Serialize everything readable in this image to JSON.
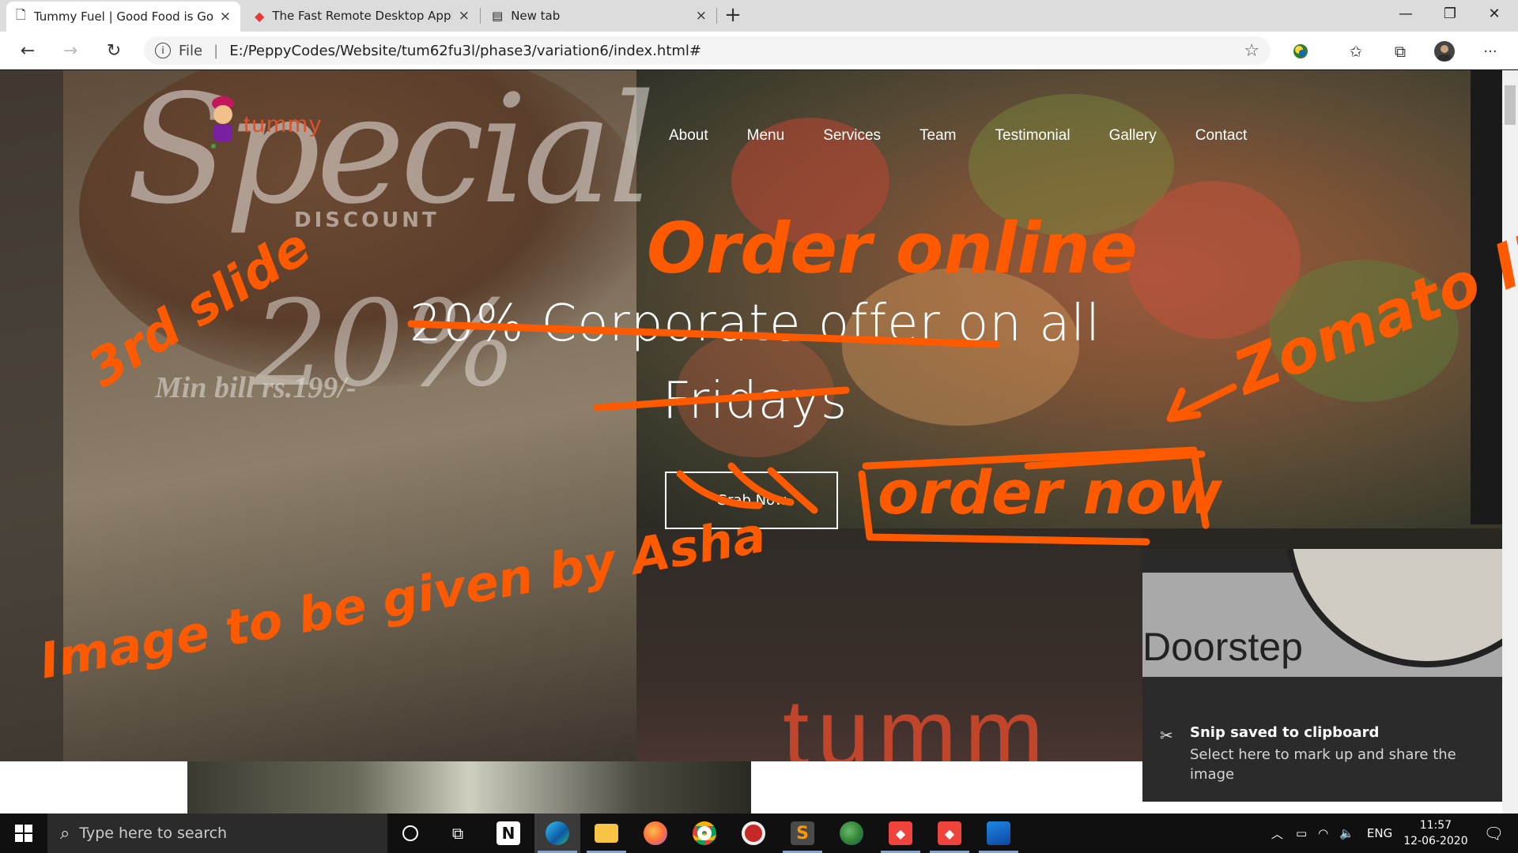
{
  "browser": {
    "tabs": [
      {
        "title": "Tummy Fuel | Good Food is Goo",
        "close": "×"
      },
      {
        "title": "The Fast Remote Desktop Applic",
        "close": "×"
      },
      {
        "title": "New tab",
        "close": "×"
      }
    ],
    "new_tab": "+",
    "window_controls": {
      "minimize": "—",
      "maximize": "❐",
      "close": "✕"
    },
    "address": {
      "scheme_label": "File",
      "separator": "|",
      "url": "E:/PeppyCodes/Website/tum62fu3l/phase3/variation6/index.html#"
    },
    "more_menu": "···"
  },
  "site": {
    "logo_text": "tummy",
    "nav": [
      "About",
      "Menu",
      "Services",
      "Team",
      "Testimonial",
      "Gallery",
      "Contact"
    ],
    "hero_title": "20% Corporate offer on all Fridays",
    "hero_button": "Grab Now",
    "background_text": {
      "special": "Special",
      "discount": "DISCOUNT",
      "percent": "20%",
      "min_bill": "Min bill rs.199/-",
      "brand_bottom": "tumm"
    }
  },
  "notification": {
    "image_text": "Doorstep",
    "title": "Snip saved to clipboard",
    "body": "Select here to mark up and share the image"
  },
  "taskbar": {
    "search_placeholder": "Type here to search",
    "language": "ENG",
    "time": "11:57",
    "date": "12-06-2020"
  },
  "annotations": {
    "slide": "3rd slide",
    "order_online": "Order online",
    "zomato": "Zomato link",
    "order_now": "order now",
    "image_note": "Image to be given by Asha"
  },
  "colors": {
    "annotation": "#ff5a00",
    "accent_brand": "#d9532d",
    "toast_bg": "#2b2b2b"
  }
}
